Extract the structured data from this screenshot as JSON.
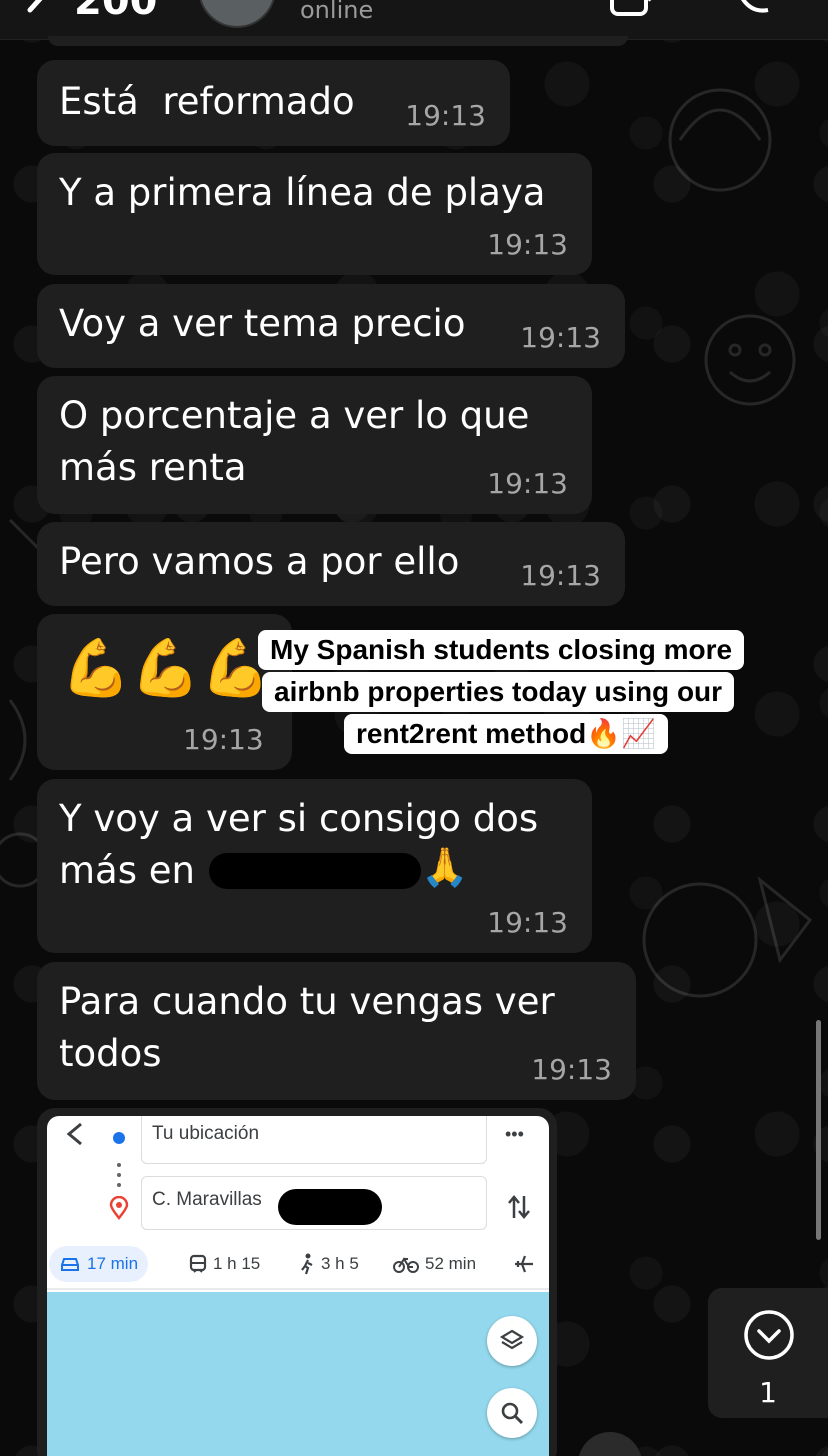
{
  "header": {
    "count": "200",
    "status": "online"
  },
  "messages": [
    {
      "text": "Está  reformado",
      "time": "19:13"
    },
    {
      "text": "Y a primera línea de playa",
      "time": "19:13"
    },
    {
      "text": "Voy a ver tema precio",
      "time": "19:13"
    },
    {
      "text": "O porcentaje a ver lo que\nmás renta",
      "time": "19:13"
    },
    {
      "text": "Pero vamos a por ello",
      "time": "19:13"
    },
    {
      "emojis": "💪💪💪",
      "time": "19:13"
    },
    {
      "text": "Y voy a ver si consigo dos\nmás en",
      "emoji": "🙏",
      "time": "19:13"
    },
    {
      "text": "Para cuando tu vengas ver\ntodos",
      "time": "19:13"
    }
  ],
  "caption": {
    "line1": "My Spanish students closing more",
    "line2": "airbnb properties today using our",
    "line3": "rent2rent method",
    "line3_emojis": "🔥📈"
  },
  "map": {
    "origin": "Tu ubicación",
    "destination": "C. Maravillas",
    "more": "•••",
    "modes": [
      {
        "icon": "car-icon",
        "label": "17 min"
      },
      {
        "icon": "train-icon",
        "label": "1 h 15"
      },
      {
        "icon": "walk-icon",
        "label": "3 h 5"
      },
      {
        "icon": "bike-icon",
        "label": "52 min"
      },
      {
        "icon": "plane-icon",
        "label": ""
      }
    ]
  },
  "scroll_down": {
    "unread": "1"
  },
  "colors": {
    "bubble": "#1f1f1f",
    "background": "#0b0b0b",
    "timestamp": "#a6a6a6",
    "maps_blue": "#1a73e8",
    "water": "#93d8ed"
  }
}
